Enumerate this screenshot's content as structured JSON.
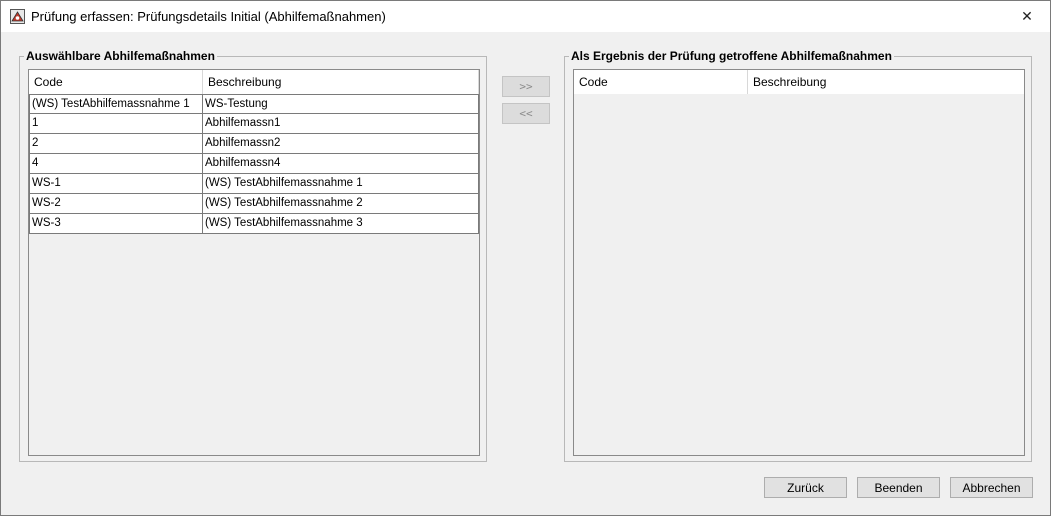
{
  "window": {
    "title": "Prüfung erfassen: Prüfungsdetails Initial (Abhilfemaßnahmen)",
    "close_glyph": "✕"
  },
  "left_panel": {
    "label": "Auswählbare Abhilfemaßnahmen",
    "columns": [
      "Code",
      "Beschreibung"
    ],
    "rows": [
      {
        "code": "(WS) TestAbhilfemassnahme 1",
        "desc": "WS-Testung"
      },
      {
        "code": "1",
        "desc": "Abhilfemassn1"
      },
      {
        "code": "2",
        "desc": "Abhilfemassn2"
      },
      {
        "code": "4",
        "desc": "Abhilfemassn4"
      },
      {
        "code": "WS-1",
        "desc": "(WS) TestAbhilfemassnahme 1"
      },
      {
        "code": "WS-2",
        "desc": "(WS) TestAbhilfemassnahme 2"
      },
      {
        "code": "WS-3",
        "desc": "(WS) TestAbhilfemassnahme 3"
      }
    ]
  },
  "transfer": {
    "add_label": ">>",
    "remove_label": "<<"
  },
  "right_panel": {
    "label": "Als Ergebnis der Prüfung getroffene Abhilfemaßnahmen",
    "columns": [
      "Code",
      "Beschreibung"
    ],
    "rows": []
  },
  "footer": {
    "back_label": "Zurück",
    "finish_label": "Beenden",
    "cancel_label": "Abbrechen"
  }
}
